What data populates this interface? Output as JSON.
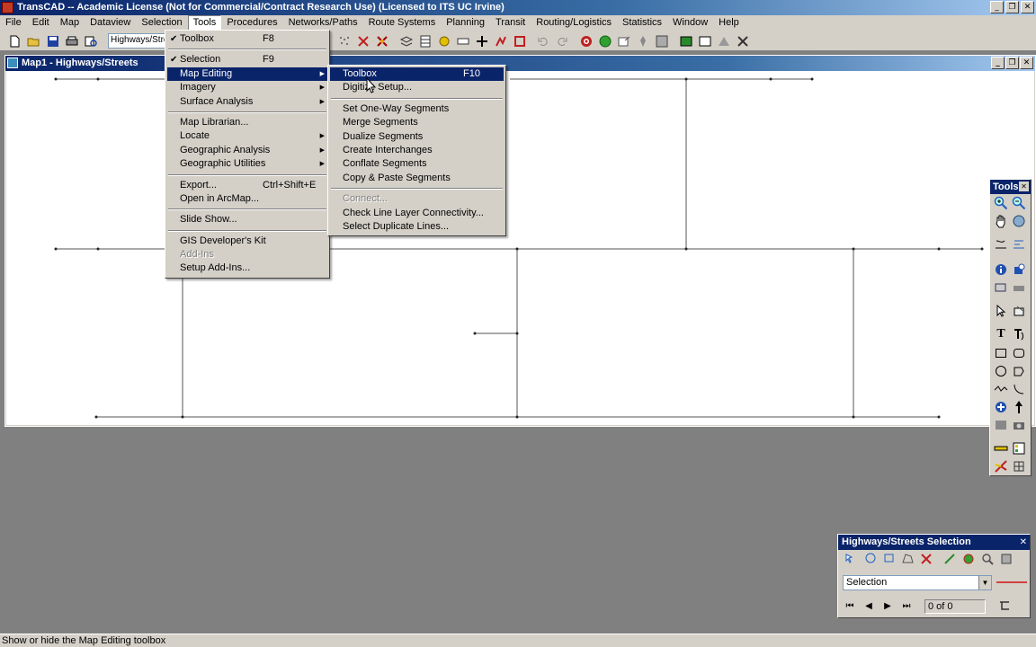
{
  "app": {
    "title": "TransCAD -- Academic License (Not for Commercial/Contract Research Use) (Licensed to ITS UC Irvine)"
  },
  "menubar": [
    "File",
    "Edit",
    "Map",
    "Dataview",
    "Selection",
    "Tools",
    "Procedures",
    "Networks/Paths",
    "Route Systems",
    "Planning",
    "Transit",
    "Routing/Logistics",
    "Statistics",
    "Window",
    "Help"
  ],
  "toolbar": {
    "layer_value": "Highways/Streets"
  },
  "map_window": {
    "title": "Map1 - Highways/Streets"
  },
  "tools_menu": {
    "items": [
      {
        "label": "Toolbox",
        "shortcut": "F8",
        "checked": true
      },
      {
        "label": "Selection",
        "shortcut": "F9",
        "checked": true
      },
      {
        "label": "Map Editing",
        "submenu": true
      },
      {
        "label": "Imagery",
        "submenu": true
      },
      {
        "label": "Surface Analysis",
        "submenu": true
      },
      {
        "label": "Map Librarian..."
      },
      {
        "label": "Locate",
        "submenu": true
      },
      {
        "label": "Geographic Analysis",
        "submenu": true
      },
      {
        "label": "Geographic Utilities",
        "submenu": true
      },
      {
        "label": "Export...",
        "shortcut": "Ctrl+Shift+E"
      },
      {
        "label": "Open in ArcMap..."
      },
      {
        "label": "Slide Show..."
      },
      {
        "label": "GIS Developer's Kit"
      },
      {
        "label": "Add-Ins"
      },
      {
        "label": "Setup Add-Ins..."
      }
    ]
  },
  "map_editing_menu": {
    "items": [
      {
        "label": "Toolbox",
        "shortcut": "F10"
      },
      {
        "label": "Digitize Setup..."
      },
      {
        "label": "Set One-Way Segments"
      },
      {
        "label": "Merge Segments"
      },
      {
        "label": "Dualize Segments"
      },
      {
        "label": "Create Interchanges"
      },
      {
        "label": "Conflate Segments"
      },
      {
        "label": "Copy & Paste Segments"
      },
      {
        "label": "Connect..."
      },
      {
        "label": "Check Line Layer Connectivity..."
      },
      {
        "label": "Select Duplicate Lines..."
      }
    ]
  },
  "tools_palette": {
    "title": "Tools",
    "text_tool_glyph": "T"
  },
  "selection_palette": {
    "title": "Highways/Streets Selection",
    "set_value": "Selection",
    "count_text": "0 of 0",
    "swatch_color": "#d04040"
  },
  "status": {
    "text": "Show or hide the Map Editing toolbox"
  },
  "colors": {
    "title_active": "#0a246a",
    "menu_highlight": "#0a246a",
    "face": "#d4d0c8",
    "workspace": "#808080"
  },
  "icons": {
    "menu_check": "✔",
    "submenu_arrow": "▶",
    "close": "✕",
    "minimize": "_",
    "restore": "❐",
    "dropdown": "▼",
    "first": "⏮",
    "prev": "◀",
    "next": "▶",
    "last": "⏭"
  }
}
